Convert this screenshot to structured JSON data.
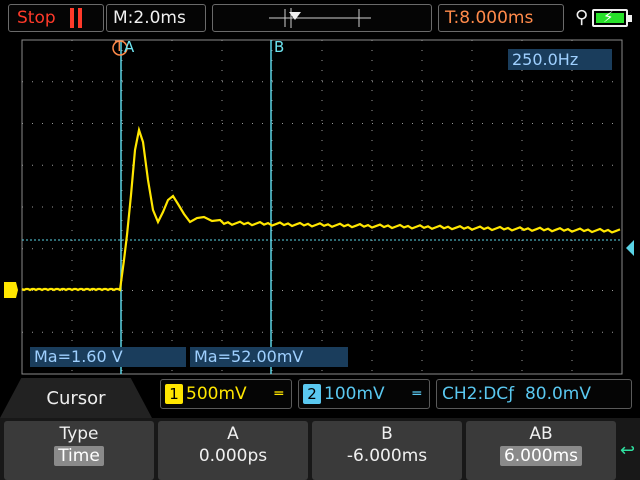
{
  "top": {
    "run_state": "Stop",
    "timebase": "M:2.0ms",
    "trigger_time": "T:8.000ms"
  },
  "plot": {
    "frequency": "250.0Hz",
    "cursor_a_label": "A",
    "cursor_b_label": "B",
    "trigger_marker": "T",
    "measure_a": "Ma=1.60 V",
    "measure_b": "Ma=52.00mV"
  },
  "channels": {
    "tab_label": "Cursor",
    "ch1": {
      "number": "1",
      "scale": "500mV",
      "coupling": "═",
      "color": "#ffe600"
    },
    "ch2": {
      "number": "2",
      "scale": "100mV",
      "coupling": "═",
      "color": "#5ac8f0"
    },
    "trigger_info": "CH2:DCƒ  80.0mV"
  },
  "menu": [
    {
      "title": "Type",
      "value": "Time"
    },
    {
      "title": "A",
      "value": "0.000ps"
    },
    {
      "title": "B",
      "value": "-6.000ms"
    },
    {
      "title": "AB",
      "value": "6.000ms"
    }
  ],
  "colors": {
    "ch1_trace": "#ffe600",
    "ch2_trace": "#5ac8f0",
    "stop": "#ff3a2a",
    "trigger": "#ff8a4a"
  }
}
